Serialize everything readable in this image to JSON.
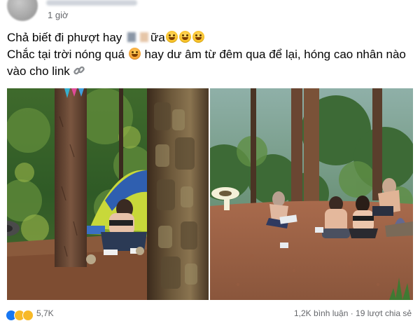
{
  "post": {
    "time": "1 giờ",
    "text_line1_part1": "Chả biết đi phượt hay ",
    "text_line1_part2": "ữa",
    "text_line2_part1": "Chắc tại trời nóng quá ",
    "text_line2_part2": " hay dư âm từ đêm qua để lại, hóng cao nhân nào",
    "text_line3": "vào cho link"
  },
  "footer": {
    "reaction_count": "5,7K",
    "stats": "1,2K bình luận · 19 lượt chia sẻ"
  },
  "icons": [
    "avatar",
    "grinning-emoji",
    "hot-face-emoji",
    "link-icon",
    "like-reaction-icon",
    "haha-reaction-icon"
  ],
  "colors": {
    "text": "#050505",
    "secondary": "#65676b",
    "link": "#8a8d91"
  }
}
